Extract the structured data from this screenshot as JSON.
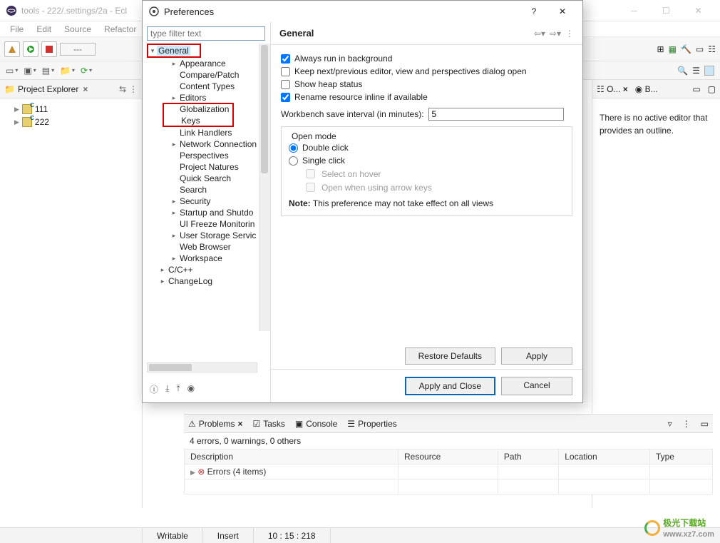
{
  "main_window": {
    "title": "tools - 222/.settings/2a - Ecl",
    "menubar": [
      "File",
      "Edit",
      "Source",
      "Refactor"
    ],
    "project_explorer": {
      "tab_label": "Project Explorer",
      "items": [
        "111",
        "222"
      ]
    },
    "right_pane": {
      "tab1": "O...",
      "tab2": "B...",
      "message": "There is no active editor that provides an outline."
    },
    "bottom": {
      "tabs": [
        "Problems",
        "Tasks",
        "Console",
        "Properties"
      ],
      "summary": "4 errors, 0 warnings, 0 others",
      "columns": [
        "Description",
        "Resource",
        "Path",
        "Location",
        "Type"
      ],
      "row1": "Errors (4 items)"
    },
    "statusbar": {
      "c1": "Writable",
      "c2": "Insert",
      "c3": "10 : 15 : 218"
    }
  },
  "dialog": {
    "title": "Preferences",
    "filter_placeholder": "type filter text",
    "tree": {
      "general": "General",
      "children": [
        "Appearance",
        "Compare/Patch",
        "Content Types",
        "Editors",
        "Globalization",
        "Keys",
        "Link Handlers",
        "Network Connection",
        "Perspectives",
        "Project Natures",
        "Quick Search",
        "Search",
        "Security",
        "Startup and Shutdo",
        "UI Freeze Monitorin",
        "User Storage Servic",
        "Web Browser",
        "Workspace"
      ],
      "expanders_at": [
        0,
        3,
        7,
        12,
        13,
        15,
        17
      ],
      "other_roots": [
        "C/C++",
        "ChangeLog"
      ]
    },
    "page": {
      "heading": "General",
      "chk_bg": "Always run in background",
      "chk_keep": "Keep next/previous editor, view and perspectives dialog open",
      "chk_heap": "Show heap status",
      "chk_rename": "Rename resource inline if available",
      "interval_label": "Workbench save interval (in minutes):",
      "interval_value": "5",
      "open_mode_legend": "Open mode",
      "radio_double": "Double click",
      "radio_single": "Single click",
      "sub_hover": "Select on hover",
      "sub_arrow": "Open when using arrow keys",
      "note_label": "Note:",
      "note_text": "This preference may not take effect on all views",
      "btn_restore": "Restore Defaults",
      "btn_apply": "Apply",
      "btn_apply_close": "Apply and Close",
      "btn_cancel": "Cancel"
    }
  },
  "watermark": {
    "text": "极光下载站",
    "url": "www.xz7.com"
  }
}
